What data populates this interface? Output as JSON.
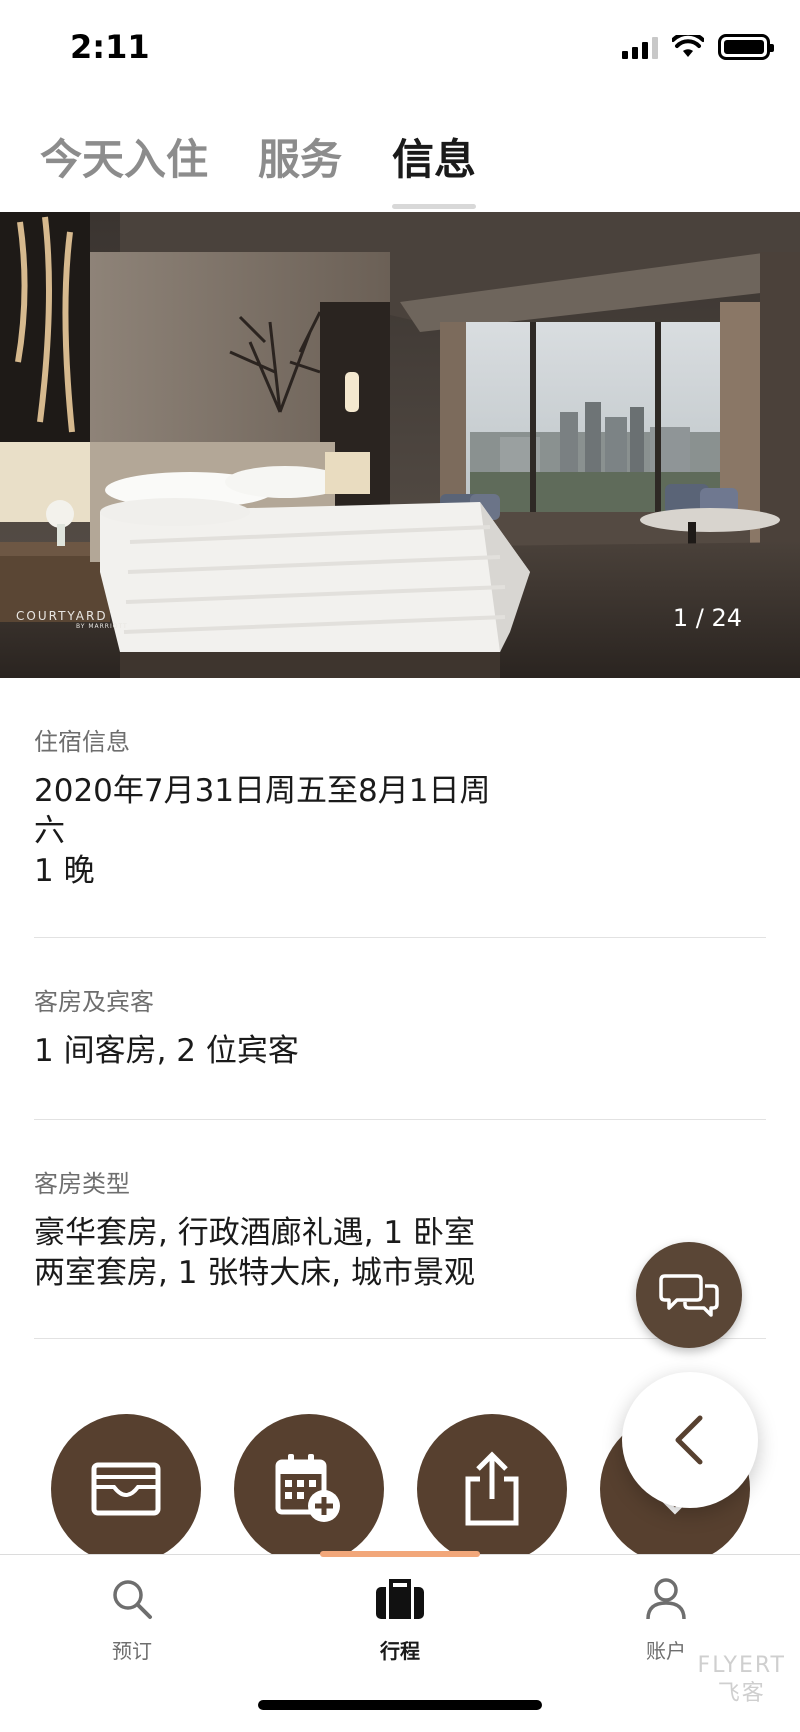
{
  "status_bar": {
    "time": "2:11"
  },
  "tabs": [
    {
      "label": "今天入住",
      "active": false
    },
    {
      "label": "服务",
      "active": false
    },
    {
      "label": "信息",
      "active": true
    }
  ],
  "hero": {
    "counter": "1 / 24",
    "logo_text": "COURTYARD",
    "logo_sub": "BY MARRIOTT"
  },
  "stay_info": {
    "label": "住宿信息",
    "dates_line1": "2020年7月31日周五至8月1日周",
    "dates_line2": "六",
    "nights": "1 晚"
  },
  "rooms_guests": {
    "label": "客房及宾客",
    "value": "1 间客房, 2 位宾客"
  },
  "room_type": {
    "label": "客房类型",
    "line1": "豪华套房, 行政酒廊礼遇, 1 卧室",
    "line2": "两室套房, 1  张特大床, 城市景观"
  },
  "bottom_nav": [
    {
      "label": "预订",
      "icon": "search-icon",
      "active": false
    },
    {
      "label": "行程",
      "icon": "briefcase-icon",
      "active": true
    },
    {
      "label": "账户",
      "icon": "person-icon",
      "active": false
    }
  ],
  "watermark": {
    "line1": "FLYERT",
    "line2": "飞客"
  },
  "colors": {
    "brand_brown": "#57402f",
    "accent_orange": "#f2a77a"
  }
}
